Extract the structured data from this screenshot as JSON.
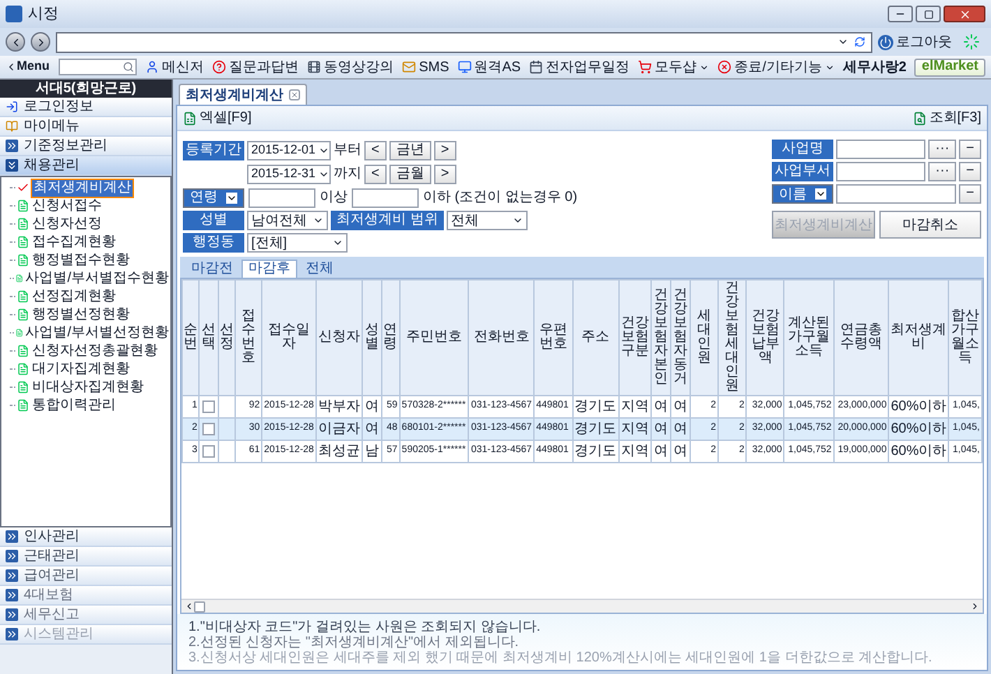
{
  "window": {
    "title": "시정"
  },
  "address_bar": {
    "logout": "로그아웃"
  },
  "toolbar": {
    "menu_label": "Menu",
    "items": [
      {
        "label": "메신저",
        "kind": "user",
        "dropdown": false
      },
      {
        "label": "질문과답변",
        "kind": "help",
        "dropdown": false
      },
      {
        "label": "동영상강의",
        "kind": "film",
        "dropdown": false
      },
      {
        "label": "SMS",
        "kind": "mail",
        "dropdown": false
      },
      {
        "label": "원격AS",
        "kind": "monitor",
        "dropdown": false
      },
      {
        "label": "전자업무일정",
        "kind": "calendar",
        "dropdown": false
      },
      {
        "label": "모두샵",
        "kind": "cart",
        "dropdown": true
      },
      {
        "label": "종료/기타기능",
        "kind": "exit",
        "dropdown": true
      }
    ],
    "brand": "세무사랑2",
    "market": "elMarket"
  },
  "sidebar": {
    "title": "서대5(희망근로)",
    "items": [
      {
        "label": "로그인정보",
        "kind": "login",
        "selected": false
      },
      {
        "label": "마이메뉴",
        "kind": "book",
        "selected": false
      },
      {
        "label": "기준정보관리",
        "kind": "group",
        "expanded": false,
        "selected": false
      },
      {
        "label": "채용관리",
        "kind": "group",
        "expanded": true,
        "selected": true,
        "children": [
          {
            "label": "최저생계비계산",
            "selected": true
          },
          {
            "label": "신청서접수",
            "selected": false
          },
          {
            "label": "신청자선정",
            "selected": false
          },
          {
            "label": "접수집계현황",
            "selected": false
          },
          {
            "label": "행정별접수현황",
            "selected": false
          },
          {
            "label": "사업별/부서별접수현황",
            "selected": false
          },
          {
            "label": "선정집계현황",
            "selected": false
          },
          {
            "label": "행정별선정현황",
            "selected": false
          },
          {
            "label": "사업별/부서별선정현황",
            "selected": false
          },
          {
            "label": "신청자선정총괄현황",
            "selected": false
          },
          {
            "label": "대기자집계현황",
            "selected": false
          },
          {
            "label": "비대상자집계현황",
            "selected": false
          },
          {
            "label": "통합이력관리",
            "selected": false
          }
        ]
      },
      {
        "label": "인사관리",
        "kind": "group",
        "expanded": false,
        "selected": false
      },
      {
        "label": "근태관리",
        "kind": "group",
        "expanded": false,
        "selected": false
      },
      {
        "label": "급여관리",
        "kind": "group",
        "expanded": false,
        "selected": false
      },
      {
        "label": "4대보험",
        "kind": "group",
        "expanded": false,
        "selected": false
      },
      {
        "label": "세무신고",
        "kind": "group",
        "expanded": false,
        "selected": false
      },
      {
        "label": "시스템관리",
        "kind": "group",
        "expanded": false,
        "selected": false
      }
    ]
  },
  "doc_tabs": [
    {
      "label": "최저생계비계산",
      "selected": true
    }
  ],
  "actions": {
    "excel": "엑셀[F9]",
    "query": "조회[F3]"
  },
  "form": {
    "period": {
      "label": "등록기간",
      "from": "2015-12-01",
      "from_suffix": "부터",
      "year_button": "금년",
      "to": "2015-12-31",
      "to_suffix": "까지",
      "month_button": "금월",
      "prev": "<",
      "next": ">"
    },
    "age": {
      "label": "연령",
      "min_suffix": "이상",
      "max_suffix": "이하 (조건이 없는경우 0)"
    },
    "gender": {
      "label": "성별",
      "value": "남여전체"
    },
    "range": {
      "label": "최저생계비 범위",
      "value": "전체"
    },
    "district": {
      "label": "행정동",
      "value": "[전체]"
    },
    "business": {
      "label": "사업명",
      "more": "···",
      "clear": "−"
    },
    "department": {
      "label": "사업부서",
      "more": "···",
      "clear": "−"
    },
    "name": {
      "label": "이름",
      "clear": "−"
    },
    "buttons": [
      {
        "label": "최저생계비계산",
        "disabled": true
      },
      {
        "label": "마감취소",
        "disabled": false
      }
    ]
  },
  "sub_tabs": [
    {
      "label": "마감전",
      "selected": false
    },
    {
      "label": "마감후",
      "selected": true
    },
    {
      "label": "전체",
      "selected": false
    }
  ],
  "table": {
    "columns": [
      {
        "label": "순번",
        "kind": "num"
      },
      {
        "label": "선택",
        "kind": "check"
      },
      {
        "label": "선정",
        "kind": "empty"
      },
      {
        "label": "접수번호",
        "kind": "num"
      },
      {
        "label": "접수일자",
        "kind": "code"
      },
      {
        "label": "신청자",
        "kind": "text"
      },
      {
        "label": "성별",
        "kind": "text"
      },
      {
        "label": "연령",
        "kind": "num"
      },
      {
        "label": "주민번호",
        "kind": "code"
      },
      {
        "label": "전화번호",
        "kind": "code"
      },
      {
        "label": "우편번호",
        "kind": "code"
      },
      {
        "label": "주소",
        "kind": "text"
      },
      {
        "label": "건강보험구분",
        "kind": "text"
      },
      {
        "label": "건강보험자본인",
        "kind": "text"
      },
      {
        "label": "건강보험자동거",
        "kind": "text"
      },
      {
        "label": "세대인원",
        "kind": "num"
      },
      {
        "label": "건강보험세대인원",
        "kind": "num"
      },
      {
        "label": "건강보험납부액",
        "kind": "num"
      },
      {
        "label": "계산된가구월소득",
        "kind": "num"
      },
      {
        "label": "연금총수령액",
        "kind": "num"
      },
      {
        "label": "최저생계비",
        "kind": "text"
      },
      {
        "label": "합산가구월소득",
        "kind": "num"
      }
    ],
    "rows": [
      {
        "selected": false,
        "checked": false,
        "values": [
          "1",
          "92",
          "2015-12-28",
          "박부자",
          "여",
          "59",
          "570328-2******",
          "031-123-4567",
          "449801",
          "경기도",
          "지역",
          "여",
          "여",
          "2",
          "2",
          "32,000",
          "1,045,752",
          "23,000,000",
          "60%이하",
          "1,045,"
        ]
      },
      {
        "selected": true,
        "checked": false,
        "values": [
          "2",
          "30",
          "2015-12-28",
          "이금자",
          "여",
          "48",
          "680101-2******",
          "031-123-4567",
          "449801",
          "경기도",
          "지역",
          "여",
          "여",
          "2",
          "2",
          "32,000",
          "1,045,752",
          "20,000,000",
          "60%이하",
          "1,045,"
        ]
      },
      {
        "selected": false,
        "checked": false,
        "values": [
          "3",
          "61",
          "2015-12-28",
          "최성균",
          "남",
          "57",
          "590205-1******",
          "031-123-4567",
          "449801",
          "경기도",
          "지역",
          "여",
          "여",
          "2",
          "2",
          "32,000",
          "1,045,752",
          "19,000,000",
          "60%이하",
          "1,045,"
        ]
      }
    ]
  },
  "notes": [
    "1.\"비대상자 코드\"가 걸려있는 사원은 조회되지 않습니다.",
    "2.선정된 신청자는 \"최저생계비계산\"에서 제외됩니다.",
    "3.신청서상 세대인원은 세대주를 제외 했기 때문에 최저생계비 120%계산시에는 세대인원에 1을 더한값으로 계산합니다."
  ]
}
